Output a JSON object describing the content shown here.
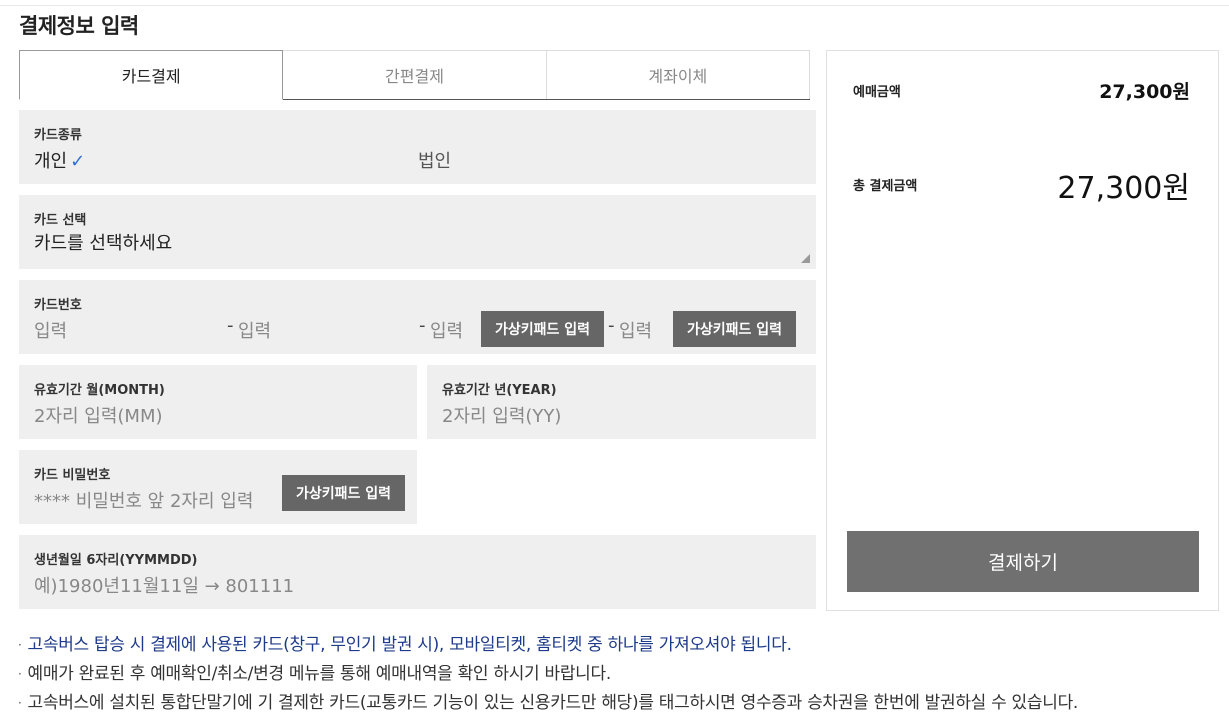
{
  "page": {
    "title": "결제정보 입력"
  },
  "tabs": [
    {
      "label": "카드결제",
      "active": true
    },
    {
      "label": "간편결제",
      "active": false
    },
    {
      "label": "계좌이체",
      "active": false
    }
  ],
  "card_type": {
    "label": "카드종류",
    "options": [
      {
        "label": "개인",
        "selected": true
      },
      {
        "label": "법인",
        "selected": false
      }
    ],
    "check_glyph": "✓"
  },
  "card_select": {
    "label": "카드 선택",
    "value": "카드를 선택하세요"
  },
  "card_number": {
    "label": "카드번호",
    "placeholder": "입력",
    "dash": "-",
    "virtual_keypad_label": "가상키패드 입력"
  },
  "expiry_month": {
    "label": "유효기간 월(MONTH)",
    "placeholder": "2자리 입력(MM)"
  },
  "expiry_year": {
    "label": "유효기간 년(YEAR)",
    "placeholder": "2자리 입력(YY)"
  },
  "card_password": {
    "label": "카드 비밀번호",
    "placeholder": "**** 비밀번호 앞 2자리 입력",
    "virtual_keypad_label": "가상키패드 입력"
  },
  "birth": {
    "label": "생년월일 6자리(YYMMDD)",
    "placeholder": "예)1980년11월11일 → 801111"
  },
  "summary": {
    "booking_label": "예매금액",
    "booking_amount": "27,300원",
    "total_label": "총 결제금액",
    "total_amount": "27,300원",
    "pay_button": "결제하기"
  },
  "notes": [
    "고속버스 탑승 시 결제에 사용된 카드(창구, 무인기 발권 시), 모바일티켓, 홈티켓 중 하나를 가져오셔야 됩니다.",
    "예매가 완료된 후 예매확인/취소/변경 메뉴를 통해 예매내역을 확인 하시기 바랍니다.",
    "고속버스에 설치된 통합단말기에 기 결제한 카드(교통카드 기능이 있는 신용카드만 해당)를 태그하시면 영수증과 승차권을 한번에 발권하실 수 있습니다."
  ],
  "note_bullet": "·",
  "colors": {
    "accent_check": "#2f6fd6",
    "button": "#707070",
    "keypad_button": "#666666",
    "field_bg": "#efefef",
    "note_blue": "#1e3a8a"
  }
}
